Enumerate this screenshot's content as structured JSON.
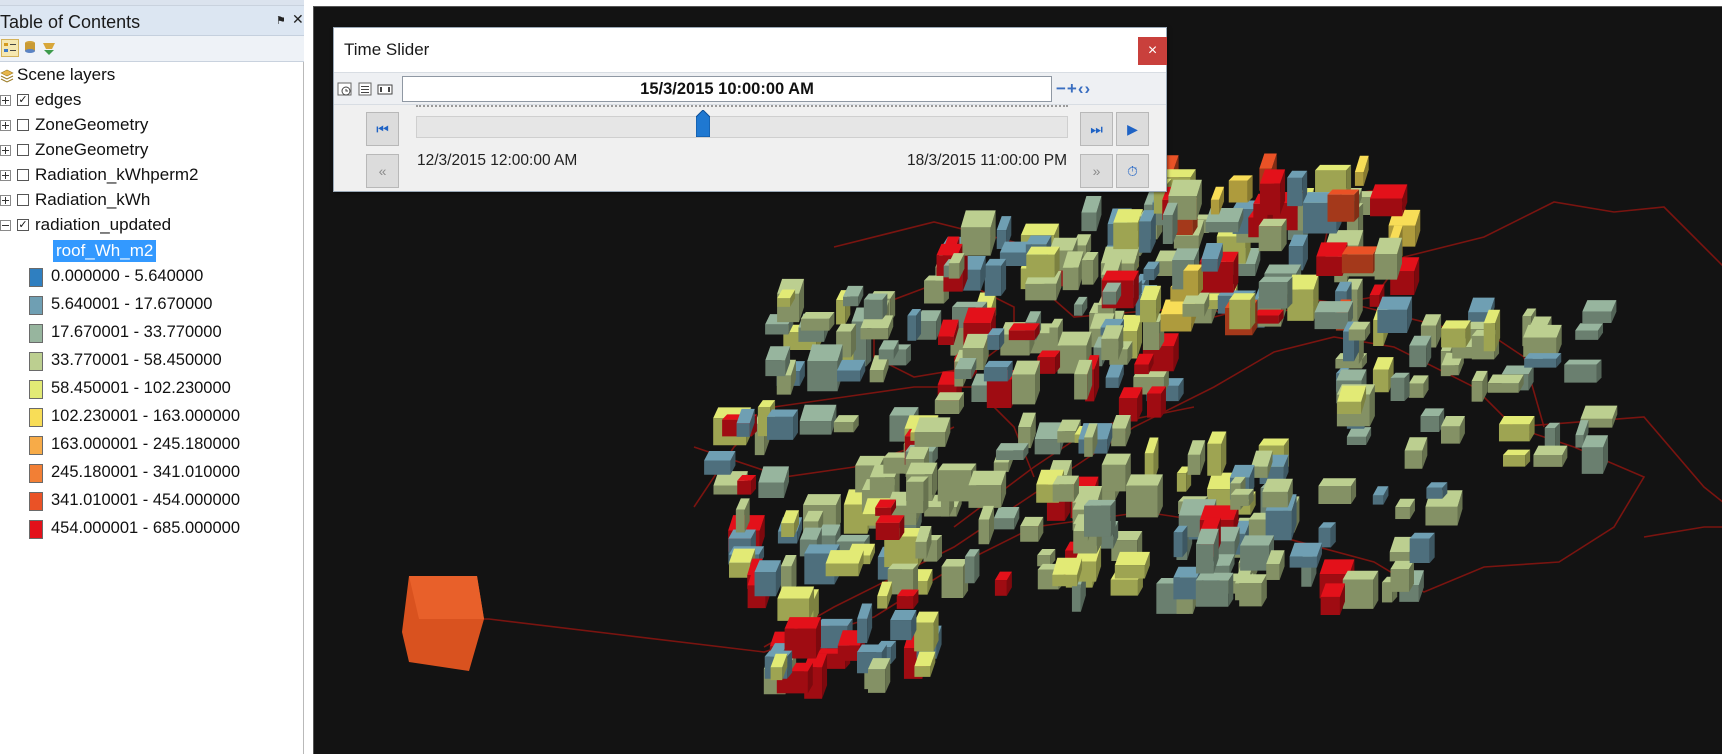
{
  "toc": {
    "title": "Table of Contents",
    "pin_glyph": "⚑",
    "close_glyph": "✕",
    "toolbar_icons": [
      "list-by-drawing-order-icon",
      "list-by-source-icon",
      "list-by-visibility-icon"
    ],
    "root": {
      "label": "Scene layers",
      "icon": "layers-icon"
    },
    "layers": [
      {
        "label": "edges",
        "checked": true,
        "expanded": false
      },
      {
        "label": "ZoneGeometry",
        "checked": false,
        "expanded": false
      },
      {
        "label": "ZoneGeometry",
        "checked": false,
        "expanded": false
      },
      {
        "label": "Radiation_kWhperm2",
        "checked": false,
        "expanded": false
      },
      {
        "label": "Radiation_kWh",
        "checked": false,
        "expanded": false
      },
      {
        "label": "radiation_updated",
        "checked": true,
        "expanded": true
      }
    ],
    "field_name": "roof_Wh_m2",
    "legend": [
      {
        "label": "0.000000 - 5.640000",
        "color": "#2f7fc0"
      },
      {
        "label": "5.640001 - 17.670000",
        "color": "#6f9fb3"
      },
      {
        "label": "17.670001 - 33.770000",
        "color": "#97b59e"
      },
      {
        "label": "33.770001 - 58.450000",
        "color": "#bccf90"
      },
      {
        "label": "58.450001 - 102.230000",
        "color": "#e2ea75"
      },
      {
        "label": "102.230001 - 163.000000",
        "color": "#f8dd57"
      },
      {
        "label": "163.000001 - 245.180000",
        "color": "#f7ab48"
      },
      {
        "label": "245.180001 - 341.010000",
        "color": "#f27f35"
      },
      {
        "label": "341.010001 - 454.000000",
        "color": "#ea5226"
      },
      {
        "label": "454.000001 - 685.000000",
        "color": "#e3111a"
      }
    ]
  },
  "time_slider": {
    "title": "Time Slider",
    "close_glyph": "×",
    "current_time": "15/3/2015 10:00:00 AM",
    "zoom_controls": "−+‹›",
    "start_time": "12/3/2015 12:00:00 AM",
    "end_time": "18/3/2015 11:00:00 PM",
    "position_fraction": 0.44,
    "buttons": {
      "go_to_start": "⏮",
      "go_to_end": "⏭",
      "play": "▶",
      "step_back": "«",
      "step_forward": "»",
      "playback_options": "⏱"
    }
  }
}
